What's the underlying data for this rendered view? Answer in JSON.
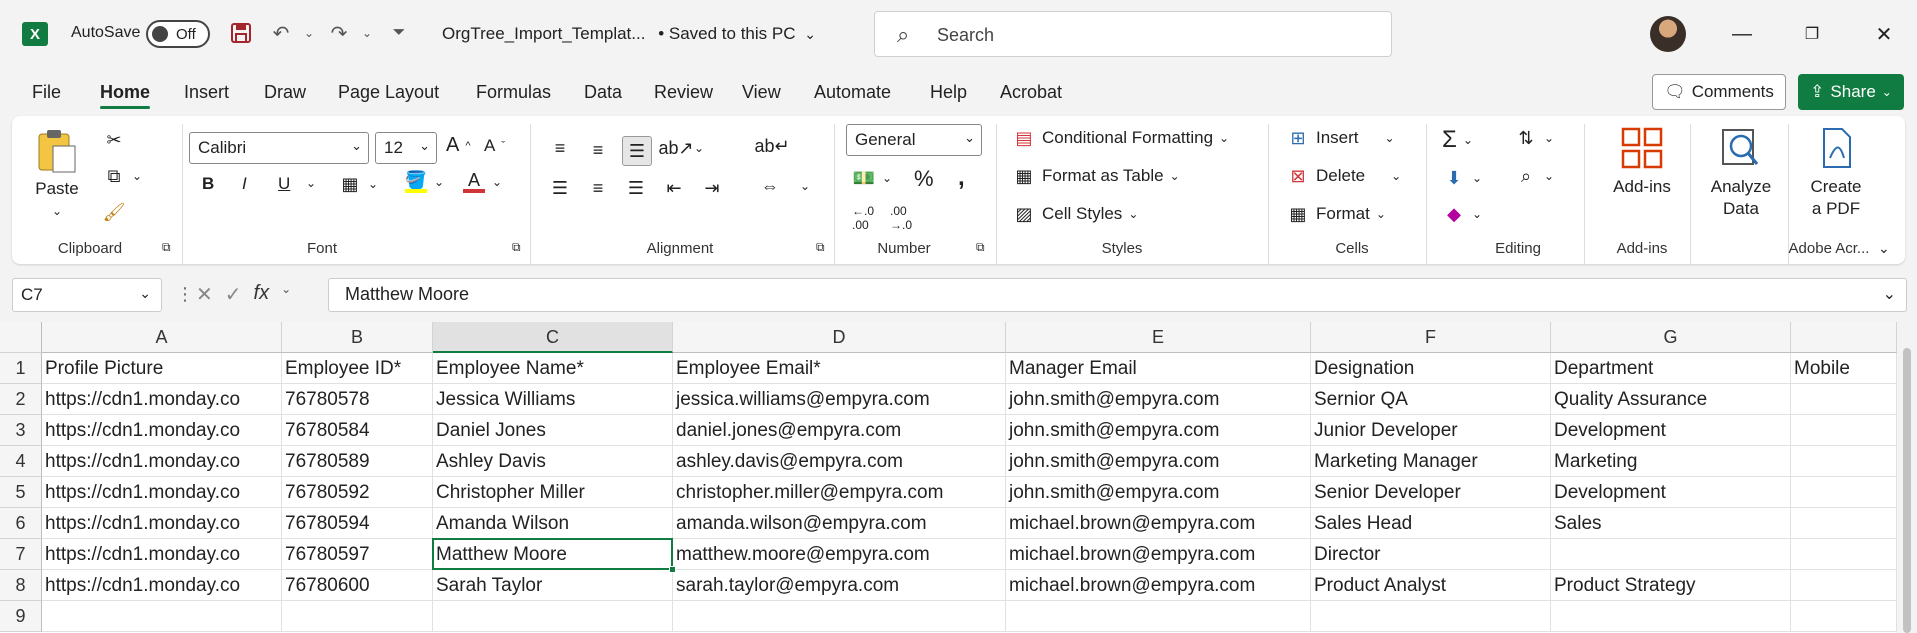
{
  "titlebar": {
    "app_icon": "excel-icon",
    "autosave_label": "AutoSave",
    "autosave_state": "Off",
    "doc_title": "OrgTree_Import_Templat...",
    "saved_status": "• Saved to this PC",
    "search_placeholder": "Search"
  },
  "menu": {
    "items": [
      "File",
      "Home",
      "Insert",
      "Draw",
      "Page Layout",
      "Formulas",
      "Data",
      "Review",
      "View",
      "Automate",
      "Help",
      "Acrobat"
    ],
    "active": "Home",
    "comments_label": "Comments",
    "share_label": "Share"
  },
  "ribbon": {
    "clipboard": {
      "label": "Clipboard",
      "paste": "Paste"
    },
    "font": {
      "label": "Font",
      "name": "Calibri",
      "size": "12",
      "bold": "B",
      "italic": "I",
      "underline": "U"
    },
    "alignment": {
      "label": "Alignment"
    },
    "number": {
      "label": "Number",
      "format": "General"
    },
    "styles": {
      "label": "Styles",
      "conditional": "Conditional Formatting",
      "format_table": "Format as Table",
      "cell_styles": "Cell Styles"
    },
    "cells": {
      "label": "Cells",
      "insert": "Insert",
      "delete": "Delete",
      "format": "Format"
    },
    "editing": {
      "label": "Editing"
    },
    "addins": {
      "label": "Add-ins",
      "button": "Add-ins"
    },
    "analyze": {
      "line1": "Analyze",
      "line2": "Data"
    },
    "acrobat": {
      "label": "Adobe Acr...",
      "line1": "Create",
      "line2": "a PDF"
    }
  },
  "formula_bar": {
    "name_box": "C7",
    "formula": "Matthew Moore"
  },
  "sheet": {
    "columns": [
      "A",
      "B",
      "C",
      "D",
      "E",
      "F",
      "G",
      ""
    ],
    "rows": [
      "1",
      "2",
      "3",
      "4",
      "5",
      "6",
      "7",
      "8",
      "9"
    ],
    "selected_column": "C",
    "active_cell": "C7",
    "header_row": [
      "Profile Picture",
      "Employee ID*",
      "Employee Name*",
      "Employee Email*",
      "Manager Email",
      "Designation",
      "Department",
      "Mobile"
    ],
    "data": [
      [
        "https://cdn1.monday.co",
        "76780578",
        "Jessica Williams",
        "jessica.williams@empyra.com",
        "john.smith@empyra.com",
        "Sernior QA",
        "Quality Assurance",
        ""
      ],
      [
        "https://cdn1.monday.co",
        "76780584",
        "Daniel Jones",
        "daniel.jones@empyra.com",
        "john.smith@empyra.com",
        "Junior Developer",
        "Development",
        ""
      ],
      [
        "https://cdn1.monday.co",
        "76780589",
        "Ashley Davis",
        "ashley.davis@empyra.com",
        "john.smith@empyra.com",
        "Marketing Manager",
        "Marketing",
        ""
      ],
      [
        "https://cdn1.monday.co",
        "76780592",
        "Christopher Miller",
        "christopher.miller@empyra.com",
        "john.smith@empyra.com",
        "Senior Developer",
        "Development",
        ""
      ],
      [
        "https://cdn1.monday.co",
        "76780594",
        "Amanda Wilson",
        "amanda.wilson@empyra.com",
        "michael.brown@empyra.com",
        "Sales Head",
        "Sales",
        ""
      ],
      [
        "https://cdn1.monday.co",
        "76780597",
        "Matthew Moore",
        "matthew.moore@empyra.com",
        "michael.brown@empyra.com",
        "Director",
        "",
        ""
      ],
      [
        "https://cdn1.monday.co",
        "76780600",
        "Sarah Taylor",
        "sarah.taylor@empyra.com",
        "michael.brown@empyra.com",
        "Product Analyst",
        "Product Strategy",
        ""
      ]
    ]
  },
  "colors": {
    "accent": "#107c41",
    "red": "#d13438",
    "highlight": "#ffff00"
  }
}
